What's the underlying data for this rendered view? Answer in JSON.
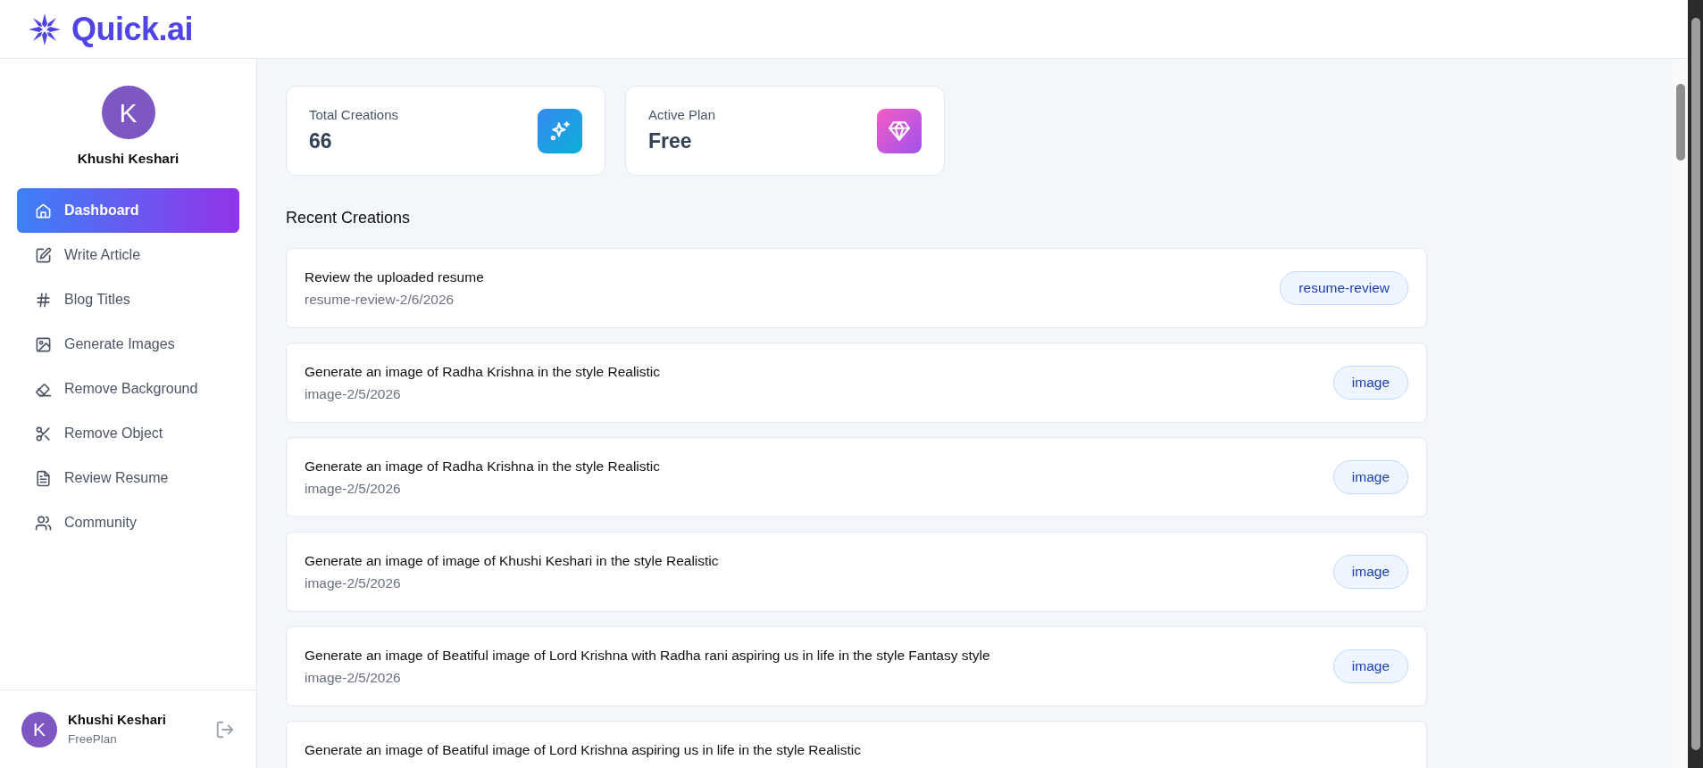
{
  "app": {
    "name": "Quick.ai"
  },
  "sidebar": {
    "user": {
      "initial": "K",
      "name": "Khushi Keshari"
    },
    "items": [
      {
        "label": "Dashboard",
        "selected": true
      },
      {
        "label": "Write Article",
        "selected": false
      },
      {
        "label": "Blog Titles",
        "selected": false
      },
      {
        "label": "Generate Images",
        "selected": false
      },
      {
        "label": "Remove Background",
        "selected": false
      },
      {
        "label": "Remove Object",
        "selected": false
      },
      {
        "label": "Review Resume",
        "selected": false
      },
      {
        "label": "Community",
        "selected": false
      }
    ],
    "footer_user": {
      "initial": "K",
      "name": "Khushi Keshari",
      "plan": "FreePlan"
    }
  },
  "stats": [
    {
      "label": "Total Creations",
      "value": "66"
    },
    {
      "label": "Active Plan",
      "value": "Free"
    }
  ],
  "recent": {
    "title": "Recent Creations",
    "items": [
      {
        "prompt": "Review the uploaded resume",
        "subtitle": "resume-review-2/6/2026",
        "tag": "resume-review"
      },
      {
        "prompt": "Generate an image of Radha Krishna in the style Realistic",
        "subtitle": "image-2/5/2026",
        "tag": "image"
      },
      {
        "prompt": "Generate an image of Radha Krishna in the style Realistic",
        "subtitle": "image-2/5/2026",
        "tag": "image"
      },
      {
        "prompt": "Generate an image of image of Khushi Keshari in the style Realistic",
        "subtitle": "image-2/5/2026",
        "tag": "image"
      },
      {
        "prompt": "Generate an image of Beatiful image of Lord Krishna with Radha rani aspiring us in life in the style Fantasy style",
        "subtitle": "image-2/5/2026",
        "tag": "image"
      },
      {
        "prompt": "Generate an image of Beatiful image of Lord Krishna aspiring us in life in the style Realistic"
      }
    ]
  }
}
